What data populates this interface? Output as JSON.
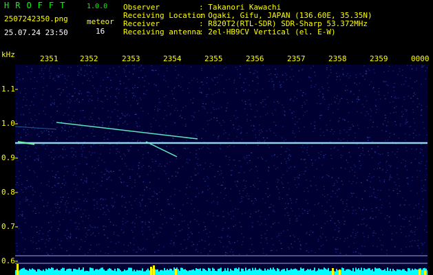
{
  "header": {
    "logo": "HROFFT",
    "version": "1.0.0",
    "filename": "2507242350.png",
    "meteor_label": "meteor",
    "datetime": "25.07.24 23:50",
    "meteor_count": "16",
    "fields": [
      {
        "label": "Observer",
        "value": ": Takanori Kawachi"
      },
      {
        "label": "Receiving Location",
        "value": ": Ogaki, Gifu, JAPAN (136.60E, 35.35N)"
      },
      {
        "label": "Receiver",
        "value": ": R820T2(RTL-SDR) SDR-Sharp 53.372MHz"
      },
      {
        "label": "Receiving antenna",
        "value": ": 2el-HB9CV Vertical (el. E-W)"
      }
    ]
  },
  "axis": {
    "y_unit": "kHz",
    "y_ticks": [
      "1.1",
      "1.0",
      "0.9",
      "0.8",
      "0.7",
      "0.6"
    ],
    "x_ticks": [
      "2351",
      "2352",
      "2353",
      "2354",
      "2355",
      "2356",
      "2357",
      "2358",
      "2359",
      "0000"
    ]
  },
  "colors": {
    "background": "#000000",
    "spectrogram_bg": "#000033",
    "noise": "#1a2a7a",
    "carrier": "#ccffff",
    "meteor": "#66ffcc",
    "bottom_band": "#00ffff",
    "bottom_peaks": "#ffff00"
  }
}
